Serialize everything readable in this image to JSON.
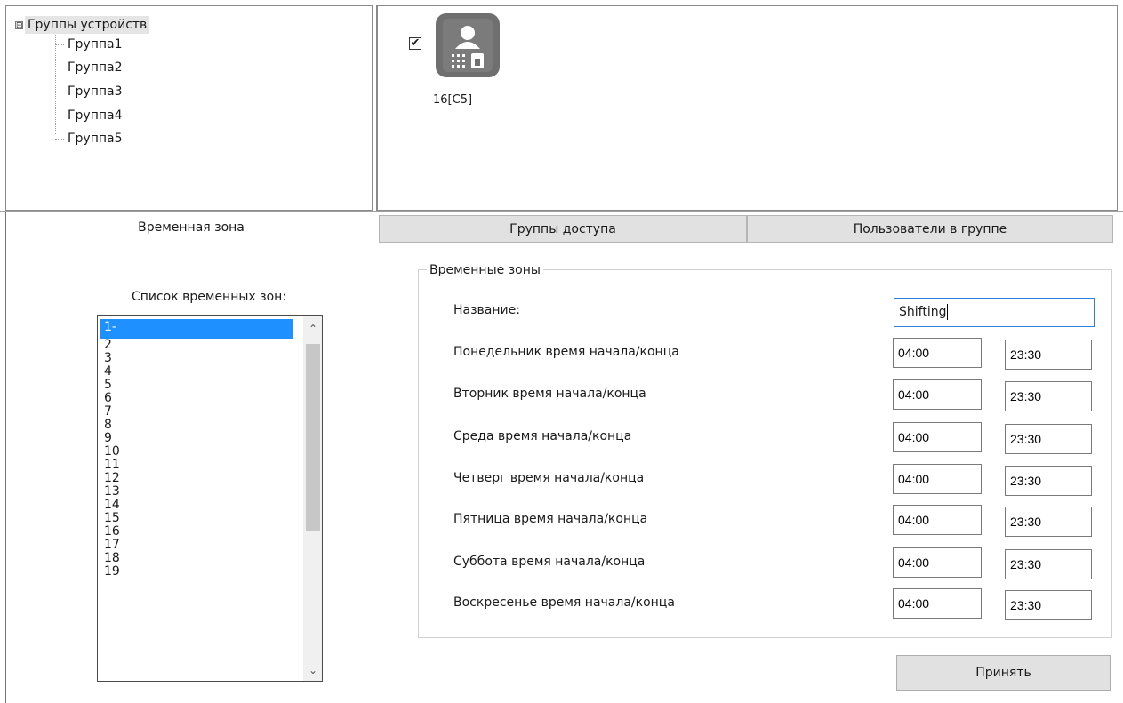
{
  "tree": {
    "root_label": "Группы устройств",
    "toggle_symbol": "⊟",
    "items": [
      "Группа1",
      "Группа2",
      "Группа3",
      "Группа4",
      "Группа5"
    ]
  },
  "device": {
    "checked_symbol": "✔",
    "label": "16[C5]",
    "icon": "access-terminal-icon"
  },
  "tabs": {
    "active": "Временная зона",
    "access_groups": "Группы доступа",
    "group_users": "Пользователи в группе"
  },
  "tz_list": {
    "title": "Список временных зон:",
    "items": [
      "1-",
      "2",
      "3",
      "4",
      "5",
      "6",
      "7",
      "8",
      "9",
      "10",
      "11",
      "12",
      "13",
      "14",
      "15",
      "16",
      "17",
      "18",
      "19"
    ],
    "selected_index": 0,
    "scroll_up": "⌃",
    "scroll_down": "⌄"
  },
  "tz_form": {
    "legend": "Временные зоны",
    "name_label": "Название:",
    "name_value": "Shifting",
    "days": [
      {
        "label": "Понедельник время начала/конца",
        "start": "04:00",
        "end": "23:30"
      },
      {
        "label": "Вторник время начала/конца",
        "start": "04:00",
        "end": "23:30"
      },
      {
        "label": "Среда время начала/конца",
        "start": "04:00",
        "end": "23:30"
      },
      {
        "label": "Четверг время начала/конца",
        "start": "04:00",
        "end": "23:30"
      },
      {
        "label": "Пятница время начала/конца",
        "start": "04:00",
        "end": "23:30"
      },
      {
        "label": "Суббота время начала/конца",
        "start": "04:00",
        "end": "23:30"
      },
      {
        "label": "Воскресенье время начала/конца",
        "start": "04:00",
        "end": "23:30"
      }
    ],
    "apply_label": "Принять"
  },
  "colors": {
    "selection": "#1e90ff",
    "device_icon": "#6f6f6f",
    "focus_border": "#2b7fd6"
  }
}
